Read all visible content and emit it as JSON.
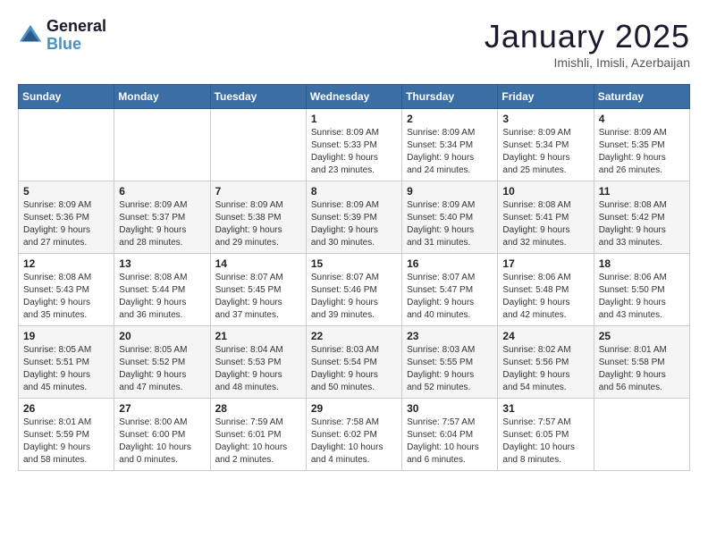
{
  "logo": {
    "line1": "General",
    "line2": "Blue"
  },
  "header": {
    "month": "January 2025",
    "location": "Imishli, Imisli, Azerbaijan"
  },
  "days_of_week": [
    "Sunday",
    "Monday",
    "Tuesday",
    "Wednesday",
    "Thursday",
    "Friday",
    "Saturday"
  ],
  "weeks": [
    [
      {
        "day": "",
        "info": ""
      },
      {
        "day": "",
        "info": ""
      },
      {
        "day": "",
        "info": ""
      },
      {
        "day": "1",
        "info": "Sunrise: 8:09 AM\nSunset: 5:33 PM\nDaylight: 9 hours\nand 23 minutes."
      },
      {
        "day": "2",
        "info": "Sunrise: 8:09 AM\nSunset: 5:34 PM\nDaylight: 9 hours\nand 24 minutes."
      },
      {
        "day": "3",
        "info": "Sunrise: 8:09 AM\nSunset: 5:34 PM\nDaylight: 9 hours\nand 25 minutes."
      },
      {
        "day": "4",
        "info": "Sunrise: 8:09 AM\nSunset: 5:35 PM\nDaylight: 9 hours\nand 26 minutes."
      }
    ],
    [
      {
        "day": "5",
        "info": "Sunrise: 8:09 AM\nSunset: 5:36 PM\nDaylight: 9 hours\nand 27 minutes."
      },
      {
        "day": "6",
        "info": "Sunrise: 8:09 AM\nSunset: 5:37 PM\nDaylight: 9 hours\nand 28 minutes."
      },
      {
        "day": "7",
        "info": "Sunrise: 8:09 AM\nSunset: 5:38 PM\nDaylight: 9 hours\nand 29 minutes."
      },
      {
        "day": "8",
        "info": "Sunrise: 8:09 AM\nSunset: 5:39 PM\nDaylight: 9 hours\nand 30 minutes."
      },
      {
        "day": "9",
        "info": "Sunrise: 8:09 AM\nSunset: 5:40 PM\nDaylight: 9 hours\nand 31 minutes."
      },
      {
        "day": "10",
        "info": "Sunrise: 8:08 AM\nSunset: 5:41 PM\nDaylight: 9 hours\nand 32 minutes."
      },
      {
        "day": "11",
        "info": "Sunrise: 8:08 AM\nSunset: 5:42 PM\nDaylight: 9 hours\nand 33 minutes."
      }
    ],
    [
      {
        "day": "12",
        "info": "Sunrise: 8:08 AM\nSunset: 5:43 PM\nDaylight: 9 hours\nand 35 minutes."
      },
      {
        "day": "13",
        "info": "Sunrise: 8:08 AM\nSunset: 5:44 PM\nDaylight: 9 hours\nand 36 minutes."
      },
      {
        "day": "14",
        "info": "Sunrise: 8:07 AM\nSunset: 5:45 PM\nDaylight: 9 hours\nand 37 minutes."
      },
      {
        "day": "15",
        "info": "Sunrise: 8:07 AM\nSunset: 5:46 PM\nDaylight: 9 hours\nand 39 minutes."
      },
      {
        "day": "16",
        "info": "Sunrise: 8:07 AM\nSunset: 5:47 PM\nDaylight: 9 hours\nand 40 minutes."
      },
      {
        "day": "17",
        "info": "Sunrise: 8:06 AM\nSunset: 5:48 PM\nDaylight: 9 hours\nand 42 minutes."
      },
      {
        "day": "18",
        "info": "Sunrise: 8:06 AM\nSunset: 5:50 PM\nDaylight: 9 hours\nand 43 minutes."
      }
    ],
    [
      {
        "day": "19",
        "info": "Sunrise: 8:05 AM\nSunset: 5:51 PM\nDaylight: 9 hours\nand 45 minutes."
      },
      {
        "day": "20",
        "info": "Sunrise: 8:05 AM\nSunset: 5:52 PM\nDaylight: 9 hours\nand 47 minutes."
      },
      {
        "day": "21",
        "info": "Sunrise: 8:04 AM\nSunset: 5:53 PM\nDaylight: 9 hours\nand 48 minutes."
      },
      {
        "day": "22",
        "info": "Sunrise: 8:03 AM\nSunset: 5:54 PM\nDaylight: 9 hours\nand 50 minutes."
      },
      {
        "day": "23",
        "info": "Sunrise: 8:03 AM\nSunset: 5:55 PM\nDaylight: 9 hours\nand 52 minutes."
      },
      {
        "day": "24",
        "info": "Sunrise: 8:02 AM\nSunset: 5:56 PM\nDaylight: 9 hours\nand 54 minutes."
      },
      {
        "day": "25",
        "info": "Sunrise: 8:01 AM\nSunset: 5:58 PM\nDaylight: 9 hours\nand 56 minutes."
      }
    ],
    [
      {
        "day": "26",
        "info": "Sunrise: 8:01 AM\nSunset: 5:59 PM\nDaylight: 9 hours\nand 58 minutes."
      },
      {
        "day": "27",
        "info": "Sunrise: 8:00 AM\nSunset: 6:00 PM\nDaylight: 10 hours\nand 0 minutes."
      },
      {
        "day": "28",
        "info": "Sunrise: 7:59 AM\nSunset: 6:01 PM\nDaylight: 10 hours\nand 2 minutes."
      },
      {
        "day": "29",
        "info": "Sunrise: 7:58 AM\nSunset: 6:02 PM\nDaylight: 10 hours\nand 4 minutes."
      },
      {
        "day": "30",
        "info": "Sunrise: 7:57 AM\nSunset: 6:04 PM\nDaylight: 10 hours\nand 6 minutes."
      },
      {
        "day": "31",
        "info": "Sunrise: 7:57 AM\nSunset: 6:05 PM\nDaylight: 10 hours\nand 8 minutes."
      },
      {
        "day": "",
        "info": ""
      }
    ]
  ]
}
